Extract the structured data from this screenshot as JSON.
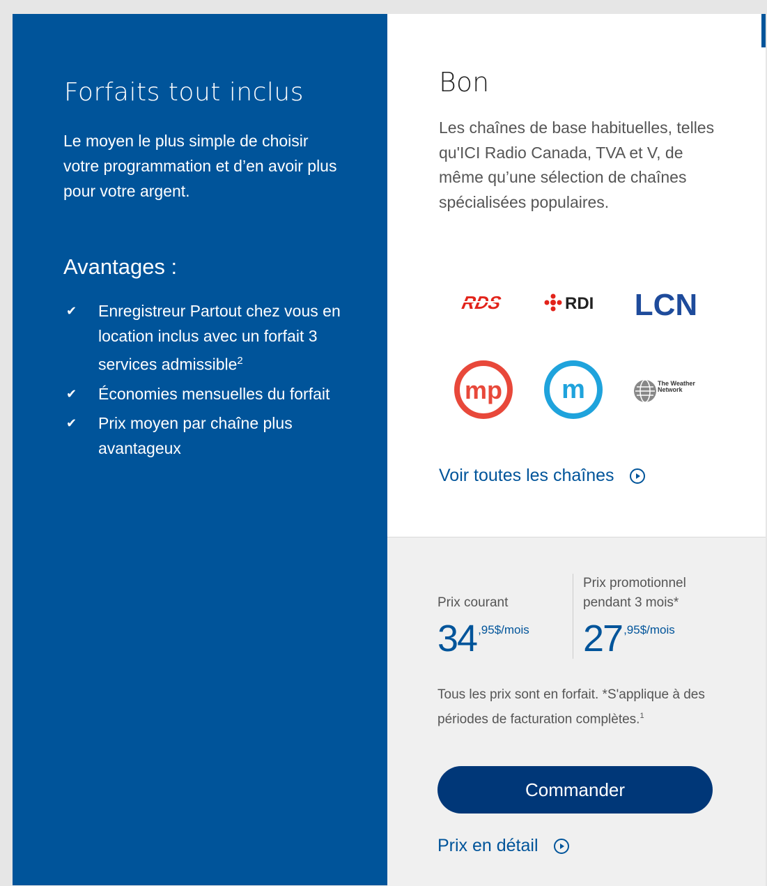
{
  "intro_panel": {
    "title": "Forfaits tout inclus",
    "description": "Le moyen le plus simple de choisir votre programmation et d’en avoir plus pour votre argent.",
    "advantages_title": "Avantages :",
    "advantages": [
      {
        "text": "Enregistreur Partout chez vous en location inclus avec un forfait 3 services admissible",
        "sup": "2"
      },
      {
        "text": "Économies mensuelles du forfait",
        "sup": ""
      },
      {
        "text": "Prix moyen par chaîne plus avantageux",
        "sup": ""
      }
    ]
  },
  "package": {
    "name": "Bon",
    "description": "Les chaînes de base habituelles, telles qu'ICI Radio Canada, TVA et V, de même qu’une sélection de chaînes spécialisées populaires.",
    "channel_logos": [
      {
        "name": "RDS",
        "label": "RDS",
        "color": "#e2231a"
      },
      {
        "name": "RDI",
        "label": "RDI",
        "color": "#222222"
      },
      {
        "name": "LCN",
        "label": "LCN",
        "color": "#1e4b9b"
      },
      {
        "name": "MP",
        "label": "mp",
        "color": "#e8483a"
      },
      {
        "name": "M",
        "label": "m",
        "color": "#1fa3dc"
      },
      {
        "name": "The Weather Network",
        "label": "The Weather Network",
        "color": "#333333"
      }
    ],
    "see_all_channels": "Voir toutes les chaînes"
  },
  "pricing": {
    "regular_label": "Prix courant",
    "regular_dollars": "34",
    "regular_cents": ",95$/mois",
    "promo_label_line1": "Prix promotionnel",
    "promo_label_line2": "pendant 3 mois*",
    "promo_dollars": "27",
    "promo_cents": ",95$/mois",
    "note": "Tous les prix sont en forfait. *S'applique à des périodes de facturation complètes.",
    "note_sup": "1",
    "order_button": "Commander",
    "price_detail_link": "Prix en détail"
  },
  "colors": {
    "brand_blue": "#00549a",
    "button_navy": "#003778"
  }
}
